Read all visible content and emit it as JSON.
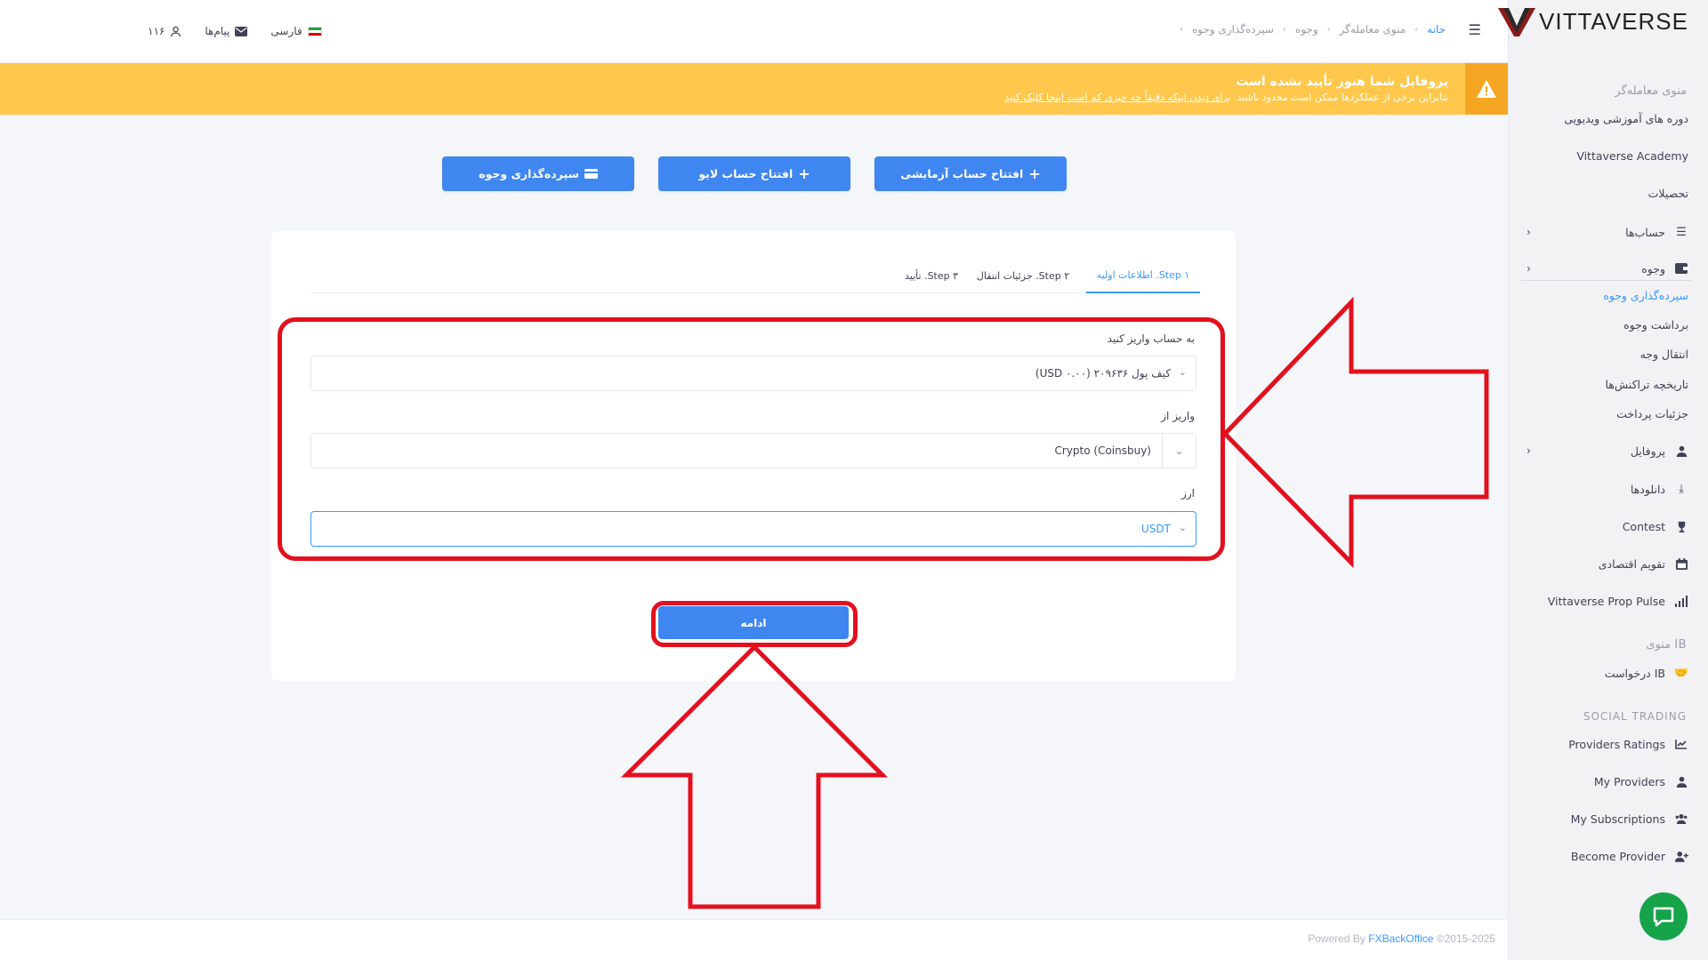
{
  "brand": {
    "name": "VITTAVERSE"
  },
  "topbar": {
    "breadcrumb": [
      "خانه",
      "منوی معامله‌گر",
      "وجوه",
      "سپرده‌گذاری وجوه"
    ],
    "language": "فارسی",
    "messages": "پیام‌ها",
    "user_id": "۱۱۶"
  },
  "alert": {
    "title": "پروفایل شما هنوز تأیید نشده است",
    "subtitle": "بنابراین برخی از عملکردها ممکن است محدود باشند.",
    "link": "برای دیدن اینکه دقیقاً چه چیزی کم است اینجا کلیک کنید"
  },
  "actions": {
    "demo": "افتتاح حساب آزمایشی",
    "live": "افتتاح حساب لایو",
    "deposit": "سپرده‌گذاری وجوه"
  },
  "tabs": [
    "Step ۱. اطلاعات اولیه",
    "Step ۲. جزئیات انتقال",
    "Step ۳. تأیید"
  ],
  "form": {
    "account_label": "به حساب واریز کنید",
    "account_value": "کیف پول ۲۰۹۶۳۶ (USD ۰.۰۰)",
    "from_label": "واریز از",
    "from_value": "Crypto (Coinsbuy)",
    "currency_label": "ارز",
    "currency_value": "USDT",
    "continue": "ادامه"
  },
  "sidebar": {
    "trader_menu": "منوی معامله‌گر",
    "items": [
      {
        "label": "دوره های آموزشی ویدیویی"
      },
      {
        "label": "Vittaverse Academy"
      },
      {
        "label": "تحصیلات"
      },
      {
        "label": "حساب‌ها"
      },
      {
        "label": "وجوه"
      }
    ],
    "funds_sub": [
      "سپرده‌گذاری وجوه",
      "برداشت وجوه",
      "انتقال وجه",
      "تاریخچه تراکنش‌ها",
      "جزئیات پرداخت"
    ],
    "items2": [
      {
        "label": "پروفایل"
      },
      {
        "label": "دانلودها"
      },
      {
        "label": "Contest"
      },
      {
        "label": "تقویم اقتصادی"
      },
      {
        "label": "Vittaverse Prop Pulse"
      }
    ],
    "ib_menu": "منوی IB",
    "ib_request": "درخواست IB",
    "social_trading": "SOCIAL TRADING",
    "social_items": [
      "Providers Ratings",
      "My Providers",
      "My Subscriptions",
      "Become Provider"
    ]
  },
  "footer": {
    "powered": "Powered By",
    "brand": "FXBackOffice",
    "copyright": "©2015-2025"
  },
  "colors": {
    "primary": "#3f86f0",
    "alert": "#ffc84c",
    "annotation": "#e3101e"
  }
}
